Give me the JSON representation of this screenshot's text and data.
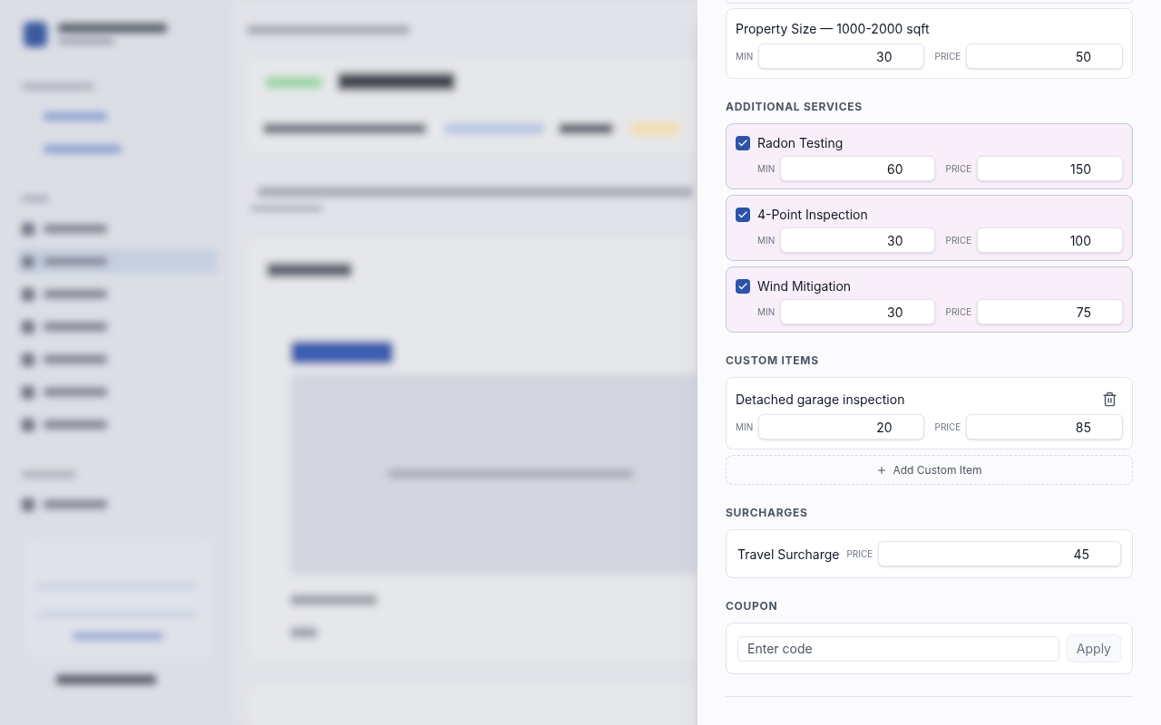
{
  "base_item": {
    "title": "Property Size — 1000-2000 sqft",
    "min_label": "MIN",
    "min": "30",
    "price_label": "PRICE",
    "price": "50"
  },
  "additional_services": {
    "heading": "ADDITIONAL SERVICES",
    "items": [
      {
        "name": "Radon Testing",
        "checked": true,
        "min_label": "MIN",
        "min": "60",
        "price_label": "PRICE",
        "price": "150"
      },
      {
        "name": "4-Point Inspection",
        "checked": true,
        "min_label": "MIN",
        "min": "30",
        "price_label": "PRICE",
        "price": "100"
      },
      {
        "name": "Wind Mitigation",
        "checked": true,
        "min_label": "MIN",
        "min": "30",
        "price_label": "PRICE",
        "price": "75"
      }
    ]
  },
  "custom_items": {
    "heading": "CUSTOM ITEMS",
    "items": [
      {
        "name": "Detached garage inspection",
        "min_label": "MIN",
        "min": "20",
        "price_label": "PRICE",
        "price": "85"
      }
    ],
    "add_button": "Add Custom Item"
  },
  "surcharges": {
    "heading": "SURCHARGES",
    "items": [
      {
        "name": "Travel Surcharge",
        "price_label": "PRICE",
        "price": "45"
      }
    ]
  },
  "coupon": {
    "heading": "COUPON",
    "placeholder": "Enter code",
    "button": "Apply"
  }
}
